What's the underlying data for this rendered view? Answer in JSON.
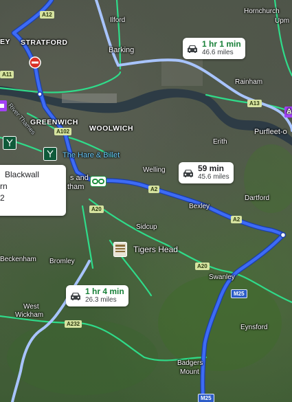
{
  "places": {
    "stratford": "STRATFORD",
    "ilford": "Ilford",
    "barking": "Barking",
    "hornchurch": "Hornchurch",
    "upminster": "Upm",
    "rainham": "Rainham",
    "greenwich": "GREENWICH",
    "woolwich": "WOOLWICH",
    "erith": "Erith",
    "purfleet": "Purfleet-o",
    "welling": "Welling",
    "bexley": "Bexley",
    "dartford": "Dartford",
    "sidcup": "Sidcup",
    "beckenham": "Beckenham",
    "bromley": "Bromley",
    "swanley": "Swanley",
    "west_wickham_1": "West",
    "west_wickham_2": "Wickham",
    "eynsford": "Eynsford",
    "badgers_1": "Badgers",
    "badgers_2": "Mount",
    "river_thames": "River Thames",
    "left_edge": "EY",
    "right_edge": "A",
    "partial_and": "s and",
    "partial_tham": "tham"
  },
  "pois": {
    "hare_billet": "The Hare & Billet",
    "tigers_head": "Tigers Head"
  },
  "road_shields": {
    "a12": "A12",
    "a11": "A11",
    "a102": "A102",
    "a13": "A13",
    "a2_1": "A2",
    "a2_2": "A2",
    "a20_1": "A20",
    "a20_2": "A20",
    "a232": "A232",
    "m25_1": "M25",
    "m25_2": "M25"
  },
  "route_callouts": {
    "selected": {
      "time": "59 min",
      "distance": "45.6 miles"
    },
    "alt_north": {
      "time": "1 hr 1 min",
      "distance": "46.6 miles"
    },
    "alt_south": {
      "time": "1 hr 4 min",
      "distance": "26.3 miles"
    }
  },
  "info_card": {
    "line1": "Blackwall",
    "line2": "rn",
    "line3": "2"
  },
  "colors": {
    "selected_route": "#2d5ff0",
    "alt_route": "#a8c4ff",
    "green_road": "#2fdc8a",
    "water": "#2a3a48",
    "callout_alt_text": "#188038"
  },
  "icons": [
    "car-icon",
    "no-entry-icon",
    "restaurant-marker-icon",
    "pub-marker-icon",
    "route-node-icon"
  ]
}
